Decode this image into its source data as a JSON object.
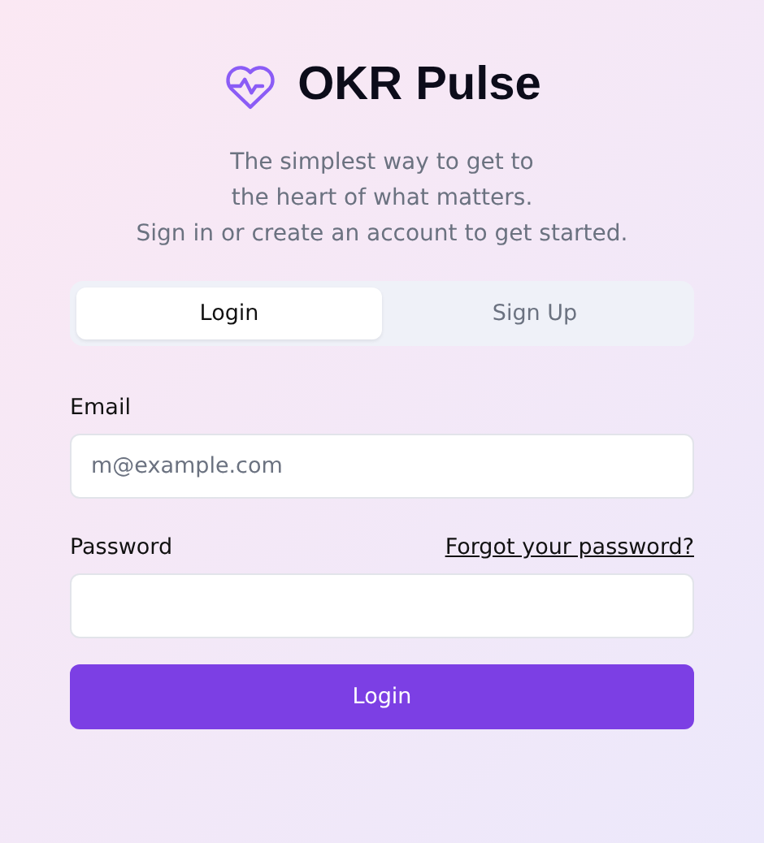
{
  "brand": {
    "name": "OKR Pulse"
  },
  "tagline": [
    "The simplest way to get to",
    "the heart of what matters.",
    "Sign in or create an account to get started."
  ],
  "tabs": [
    {
      "label": "Login",
      "selected": true
    },
    {
      "label": "Sign Up",
      "selected": false
    }
  ],
  "email": {
    "label": "Email",
    "placeholder": "m@example.com"
  },
  "password": {
    "label": "Password",
    "forgot": "Forgot your password?"
  },
  "submit": "Login"
}
